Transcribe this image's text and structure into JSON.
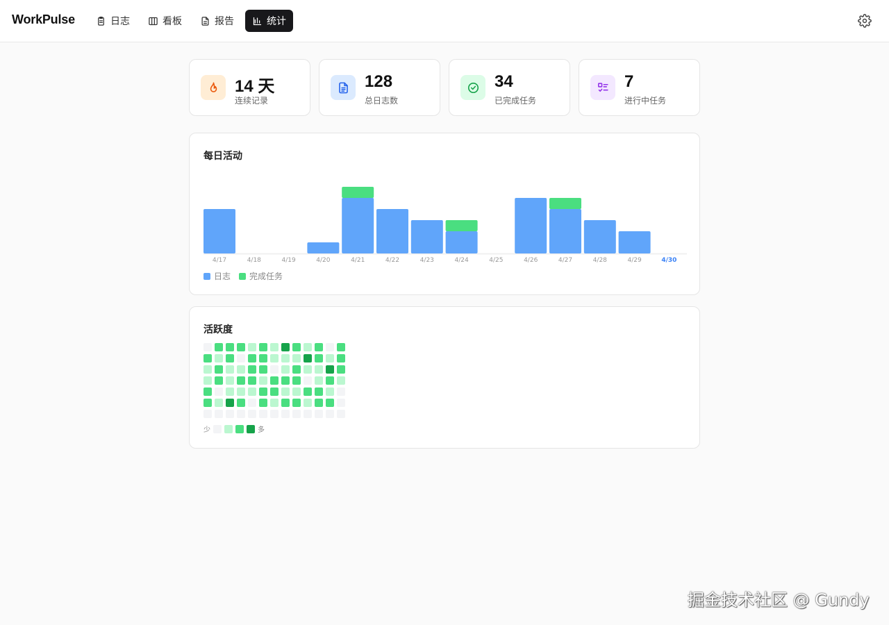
{
  "app": {
    "title": "WorkPulse"
  },
  "nav": [
    {
      "label": "日志",
      "icon": "clipboard-icon",
      "active": false
    },
    {
      "label": "看板",
      "icon": "columns-icon",
      "active": false
    },
    {
      "label": "报告",
      "icon": "document-icon",
      "active": false
    },
    {
      "label": "统计",
      "icon": "bar-chart-icon",
      "active": true
    }
  ],
  "stats": [
    {
      "value": "14 天",
      "label": "连续记录",
      "icon": "flame-icon",
      "color": "#ea580c",
      "bg": "#ffedd5"
    },
    {
      "value": "128",
      "label": "总日志数",
      "icon": "file-text-icon",
      "color": "#2563eb",
      "bg": "#dbeafe"
    },
    {
      "value": "34",
      "label": "已完成任务",
      "icon": "check-circle-icon",
      "color": "#16a34a",
      "bg": "#dcfce7"
    },
    {
      "value": "7",
      "label": "进行中任务",
      "icon": "task-list-icon",
      "color": "#9333ea",
      "bg": "#f3e8ff"
    }
  ],
  "daily": {
    "title": "每日活动",
    "legend": {
      "logs": "日志",
      "tasks": "完成任务"
    },
    "colors": {
      "logs": "#60a5fa",
      "tasks": "#4ade80",
      "today": "#3b82f6",
      "axis": "#999999"
    }
  },
  "chart_data": {
    "type": "bar",
    "stacked": true,
    "categories": [
      "4/17",
      "4/18",
      "4/19",
      "4/20",
      "4/21",
      "4/22",
      "4/23",
      "4/24",
      "4/25",
      "4/26",
      "4/27",
      "4/28",
      "4/29",
      "4/30"
    ],
    "series": [
      {
        "name": "日志",
        "values": [
          4,
          0,
          0,
          1,
          5,
          4,
          3,
          2,
          0,
          5,
          4,
          3,
          2,
          0
        ]
      },
      {
        "name": "完成任务",
        "values": [
          0,
          0,
          0,
          0,
          1,
          0,
          0,
          1,
          0,
          0,
          1,
          0,
          0,
          0
        ]
      }
    ],
    "highlight_category": "4/30",
    "grid": false
  },
  "heatmap": {
    "title": "活跃度",
    "scale_less": "少",
    "scale_more": "多",
    "palette": [
      "#f3f4f6",
      "#bbf7d0",
      "#4ade80",
      "#16a34a"
    ],
    "weeks": [
      [
        0,
        2,
        1,
        1,
        2,
        2,
        0
      ],
      [
        2,
        1,
        2,
        2,
        0,
        1,
        0
      ],
      [
        2,
        2,
        1,
        1,
        1,
        3,
        0
      ],
      [
        2,
        0,
        1,
        2,
        1,
        2,
        0
      ],
      [
        1,
        2,
        2,
        2,
        1,
        0,
        0
      ],
      [
        2,
        2,
        2,
        1,
        2,
        2,
        0
      ],
      [
        1,
        1,
        0,
        2,
        2,
        1,
        0
      ],
      [
        3,
        1,
        1,
        2,
        1,
        2,
        0
      ],
      [
        2,
        1,
        2,
        2,
        1,
        2,
        0
      ],
      [
        1,
        3,
        1,
        0,
        2,
        1,
        0
      ],
      [
        2,
        2,
        1,
        1,
        2,
        2,
        0
      ],
      [
        0,
        1,
        3,
        2,
        1,
        2,
        0
      ],
      [
        2,
        2,
        2,
        1,
        0,
        0,
        0
      ]
    ]
  },
  "watermark": "掘金技术社区 @ Gundy"
}
